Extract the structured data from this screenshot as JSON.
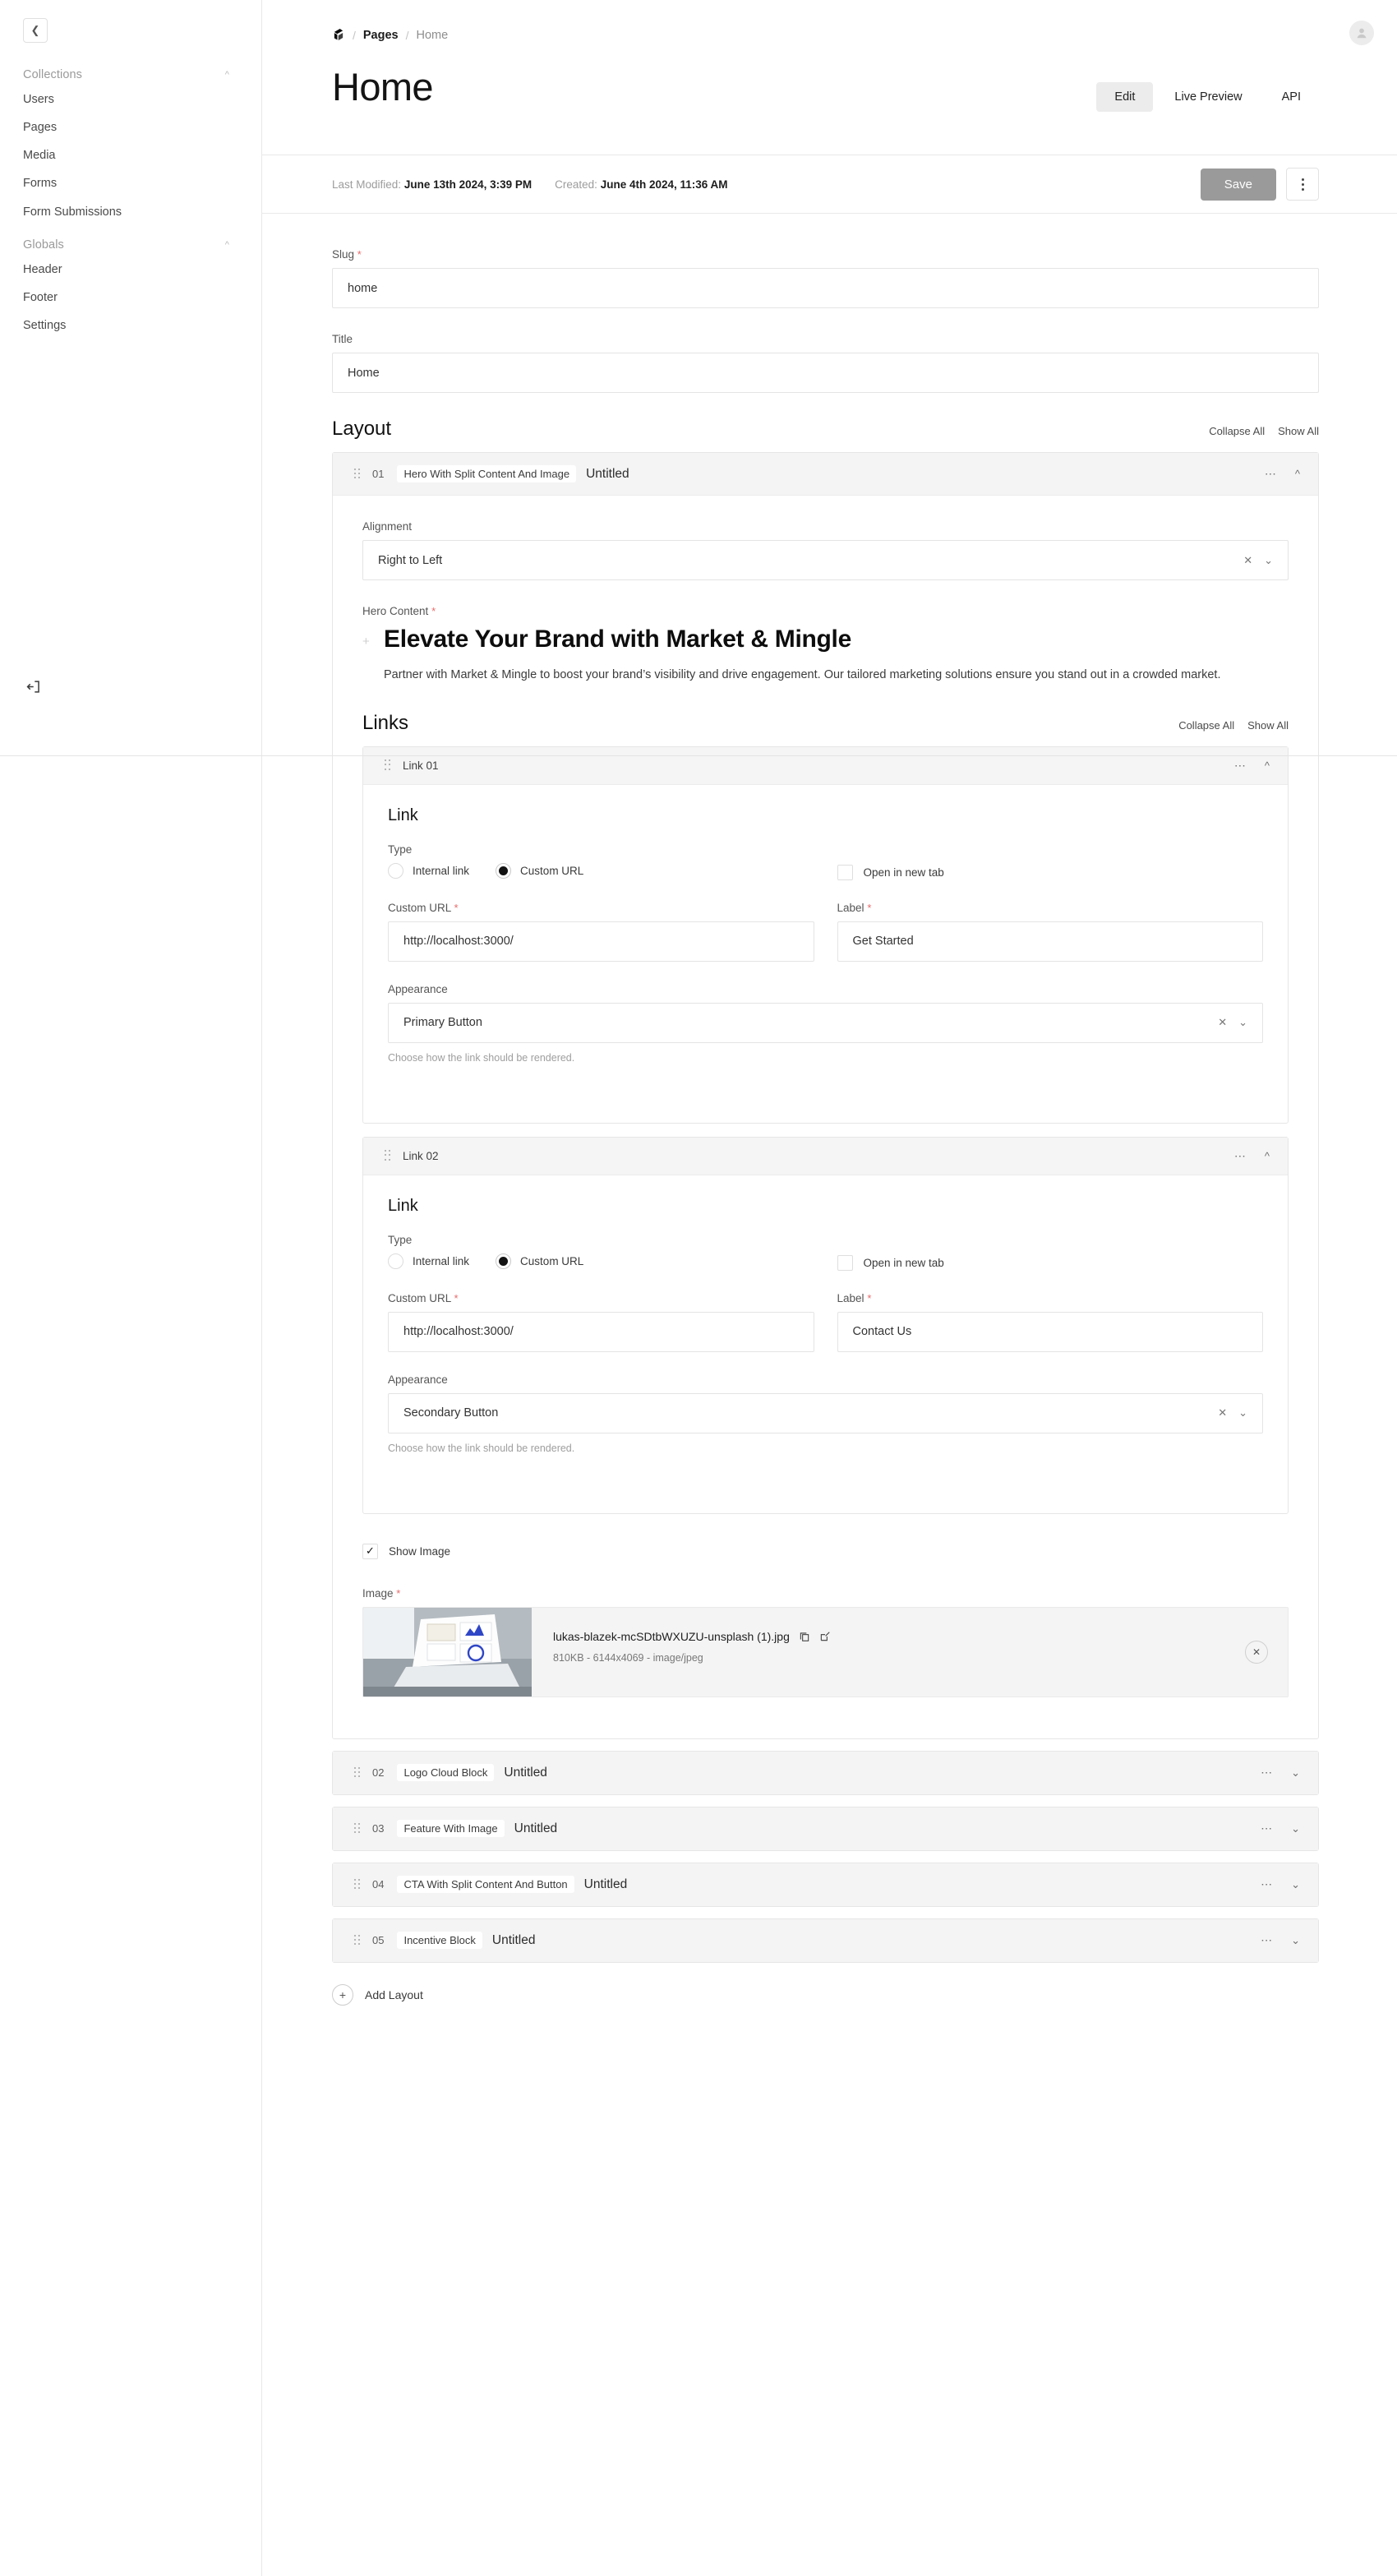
{
  "sidebar": {
    "collapse_icon": "chevron-left-icon",
    "groups": [
      {
        "label": "Collections",
        "items": [
          {
            "label": "Users"
          },
          {
            "label": "Pages"
          },
          {
            "label": "Media"
          },
          {
            "label": "Forms"
          },
          {
            "label": "Form Submissions"
          }
        ]
      },
      {
        "label": "Globals",
        "items": [
          {
            "label": "Header"
          },
          {
            "label": "Footer"
          },
          {
            "label": "Settings"
          }
        ]
      }
    ],
    "logout_icon": "logout-icon"
  },
  "header": {
    "breadcrumb": {
      "root_icon": "payload-logo-icon",
      "sep": "/",
      "collection": "Pages",
      "current": "Home"
    },
    "page_title": "Home",
    "avatar_icon": "user-avatar-icon",
    "tabs": [
      {
        "label": "Edit",
        "active": true
      },
      {
        "label": "Live Preview",
        "active": false
      },
      {
        "label": "API",
        "active": false
      }
    ]
  },
  "meta": {
    "last_modified_label": "Last Modified:",
    "last_modified_value": "June 13th 2024, 3:39 PM",
    "created_label": "Created:",
    "created_value": "June 4th 2024, 11:36 AM",
    "save_label": "Save",
    "kebab_icon": "more-vertical-icon"
  },
  "fields": {
    "slug": {
      "label": "Slug",
      "required": true,
      "value": "home"
    },
    "title": {
      "label": "Title",
      "required": false,
      "value": "Home"
    }
  },
  "layout_section": {
    "title": "Layout",
    "collapse_all": "Collapse All",
    "show_all": "Show All",
    "blocks": [
      {
        "num": "01",
        "type": "Hero With Split Content And Image",
        "name": "Untitled",
        "expanded": true,
        "chevron": "chevron-up-icon"
      },
      {
        "num": "02",
        "type": "Logo Cloud Block",
        "name": "Untitled",
        "expanded": false,
        "chevron": "chevron-down-icon"
      },
      {
        "num": "03",
        "type": "Feature With Image",
        "name": "Untitled",
        "expanded": false,
        "chevron": "chevron-down-icon"
      },
      {
        "num": "04",
        "type": "CTA With Split Content And Button",
        "name": "Untitled",
        "expanded": false,
        "chevron": "chevron-down-icon"
      },
      {
        "num": "05",
        "type": "Incentive Block",
        "name": "Untitled",
        "expanded": false,
        "chevron": "chevron-down-icon"
      }
    ],
    "add_layout": "Add Layout",
    "add_icon": "plus-icon"
  },
  "hero_block": {
    "alignment": {
      "label": "Alignment",
      "value": "Right to Left",
      "clear_icon": "clear-x-icon",
      "chevron_icon": "chevron-down-icon"
    },
    "hero_content": {
      "label": "Hero Content",
      "required": true,
      "heading": "Elevate Your Brand with Market & Mingle",
      "paragraph": "Partner with Market & Mingle to boost your brand’s visibility and drive engagement. Our tailored marketing solutions ensure you stand out in a crowded market."
    },
    "links_section": {
      "title": "Links",
      "collapse_all": "Collapse All",
      "show_all": "Show All",
      "links": [
        {
          "row_label": "Link 01",
          "panel_title": "Link",
          "type_label": "Type",
          "options": [
            {
              "label": "Internal link",
              "selected": false
            },
            {
              "label": "Custom URL",
              "selected": true
            }
          ],
          "new_tab_label": "Open in new tab",
          "new_tab_checked": false,
          "url_label": "Custom URL",
          "url_value": "http://localhost:3000/",
          "text_label": "Label",
          "text_value": "Get Started",
          "appearance_label": "Appearance",
          "appearance_value": "Primary Button",
          "appearance_help": "Choose how the link should be rendered."
        },
        {
          "row_label": "Link 02",
          "panel_title": "Link",
          "type_label": "Type",
          "options": [
            {
              "label": "Internal link",
              "selected": false
            },
            {
              "label": "Custom URL",
              "selected": true
            }
          ],
          "new_tab_label": "Open in new tab",
          "new_tab_checked": false,
          "url_label": "Custom URL",
          "url_value": "http://localhost:3000/",
          "text_label": "Label",
          "text_value": "Contact Us",
          "appearance_label": "Appearance",
          "appearance_value": "Secondary Button",
          "appearance_help": "Choose how the link should be rendered."
        }
      ]
    },
    "show_image": {
      "label": "Show Image",
      "checked": true,
      "check_icon": "check-icon"
    },
    "image": {
      "label": "Image",
      "required": true,
      "filename": "lukas-blazek-mcSDtbWXUZU-unsplash (1).jpg",
      "details": "810KB - 6144x4069 - image/jpeg",
      "copy_icon": "copy-icon",
      "edit_icon": "edit-icon",
      "remove_icon": "remove-x-icon"
    }
  },
  "colors": {
    "accent_dark": "#121212",
    "save_grey": "#9a9a9a",
    "required_red": "#e96b6b",
    "panel_grey": "#f4f4f4",
    "border": "#e6e6e6"
  }
}
